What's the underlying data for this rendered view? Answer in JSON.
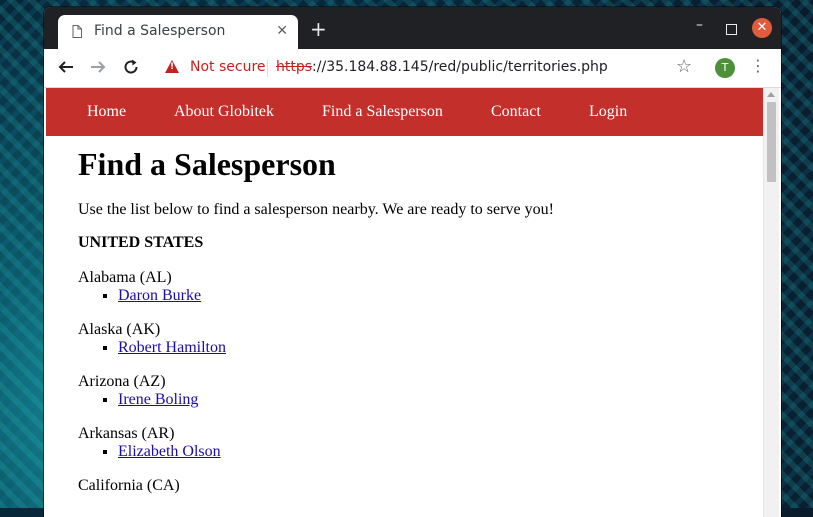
{
  "browser": {
    "tab_title": "Find a Salesperson",
    "new_tab_icon": "plus-icon",
    "security_label": "Not secure",
    "url_scheme": "https",
    "url_rest": "://35.184.88.145/red/public/territories.php",
    "profile_initial": "T",
    "close_color": "#e25b3c"
  },
  "site": {
    "brand_color": "#c3302b",
    "nav": [
      "Home",
      "About Globitek",
      "Find a Salesperson",
      "Contact",
      "Login"
    ]
  },
  "page": {
    "heading": "Find a Salesperson",
    "intro": "Use the list below to find a salesperson nearby. We are ready to serve you!",
    "country": "UNITED STATES",
    "territories": [
      {
        "state": "Alabama (AL)",
        "salespeople": [
          "Daron Burke"
        ]
      },
      {
        "state": "Alaska (AK)",
        "salespeople": [
          "Robert Hamilton"
        ]
      },
      {
        "state": "Arizona (AZ)",
        "salespeople": [
          "Irene Boling"
        ]
      },
      {
        "state": "Arkansas (AR)",
        "salespeople": [
          "Elizabeth Olson"
        ]
      },
      {
        "state": "California (CA)",
        "salespeople": []
      }
    ]
  }
}
